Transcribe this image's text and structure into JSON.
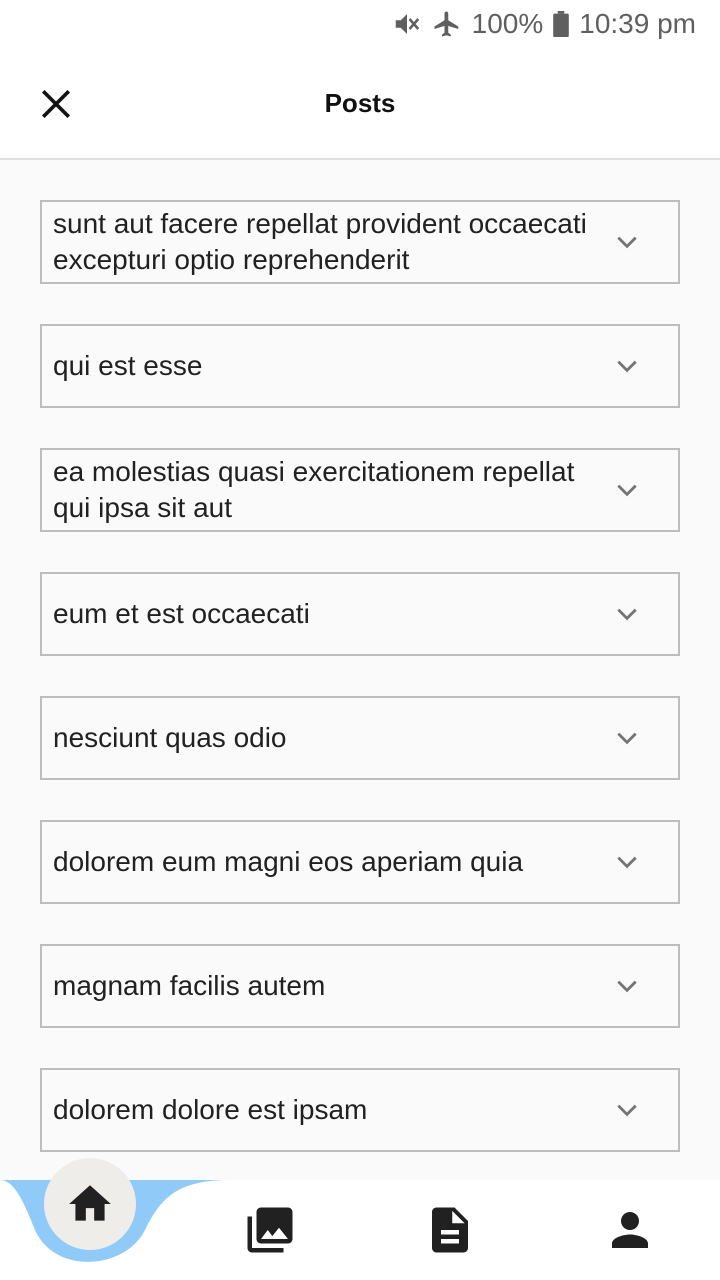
{
  "status_bar": {
    "battery": "100%",
    "time": "10:39 pm",
    "icons": [
      "mute-icon",
      "airplane-icon",
      "battery-icon"
    ]
  },
  "app_bar": {
    "title": "Posts",
    "close_icon": "close-icon"
  },
  "posts": [
    {
      "title": "sunt aut facere repellat provident occaecati excepturi optio reprehenderit"
    },
    {
      "title": "qui est esse"
    },
    {
      "title": "ea molestias quasi exercitationem repellat qui ipsa sit aut"
    },
    {
      "title": "eum et est occaecati"
    },
    {
      "title": "nesciunt quas odio"
    },
    {
      "title": "dolorem eum magni eos aperiam quia"
    },
    {
      "title": "magnam facilis autem"
    },
    {
      "title": "dolorem dolore est ipsam"
    }
  ],
  "bottom_nav": {
    "items": [
      "home-icon",
      "photo-library-icon",
      "document-icon",
      "person-icon"
    ],
    "selected": "home-icon"
  },
  "colors": {
    "accent": "#90caf9",
    "icon": "#212121",
    "border": "#bdbdbd",
    "background": "#fafafa"
  }
}
